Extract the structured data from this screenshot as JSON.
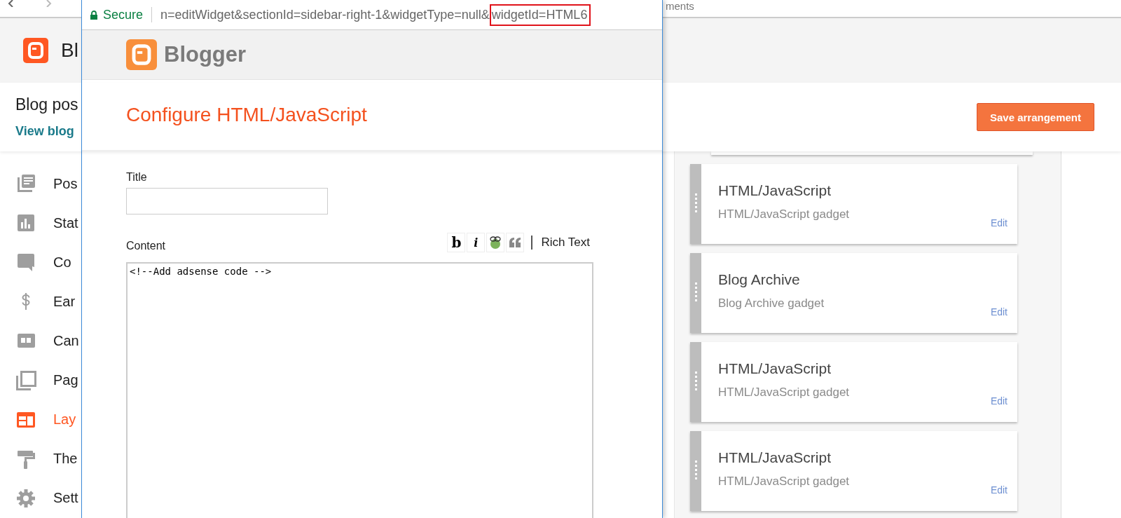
{
  "browser": {
    "tab_text": "ments"
  },
  "header": {
    "logo_text": "Bl"
  },
  "subheader": {
    "title": "Blog pos",
    "link": "View blog",
    "save_button": "Save arrangement"
  },
  "sidebar": {
    "items": [
      {
        "kind": "posts",
        "label": "Pos",
        "selected": false
      },
      {
        "kind": "stats",
        "label": "Stat",
        "selected": false
      },
      {
        "kind": "comments",
        "label": "Co",
        "selected": false
      },
      {
        "kind": "earnings",
        "label": "Ear",
        "selected": false
      },
      {
        "kind": "campaigns",
        "label": "Can",
        "selected": false
      },
      {
        "kind": "pages",
        "label": "Pag",
        "selected": false
      },
      {
        "kind": "layout",
        "label": "Lay",
        "selected": true
      },
      {
        "kind": "theme",
        "label": "The",
        "selected": false
      },
      {
        "kind": "settings",
        "label": "Sett",
        "selected": false
      }
    ]
  },
  "gadgets": [
    {
      "title": "HTML/JavaScript",
      "subtitle": "HTML/JavaScript gadget",
      "action": "Edit"
    },
    {
      "title": "Blog Archive",
      "subtitle": "Blog Archive gadget",
      "action": "Edit"
    },
    {
      "title": "HTML/JavaScript",
      "subtitle": "HTML/JavaScript gadget",
      "action": "Edit"
    },
    {
      "title": "HTML/JavaScript",
      "subtitle": "HTML/JavaScript gadget",
      "action": "Edit"
    }
  ],
  "popup": {
    "secure_label": "Secure",
    "url": "n=editWidget&sectionId=sidebar-right-1&widgetType=null&",
    "url_highlighted": "widgetId=HTML6",
    "brand": "Blogger",
    "heading": "Configure HTML/JavaScript",
    "title_label": "Title",
    "content_label": "Content",
    "toolbar": [
      {
        "kind": "bold",
        "label": "b"
      },
      {
        "kind": "italic",
        "label": "i"
      },
      {
        "kind": "link"
      },
      {
        "kind": "quote"
      }
    ],
    "rich_text_link": "Rich Text",
    "content_value": "<!--Add adsense code -->"
  }
}
